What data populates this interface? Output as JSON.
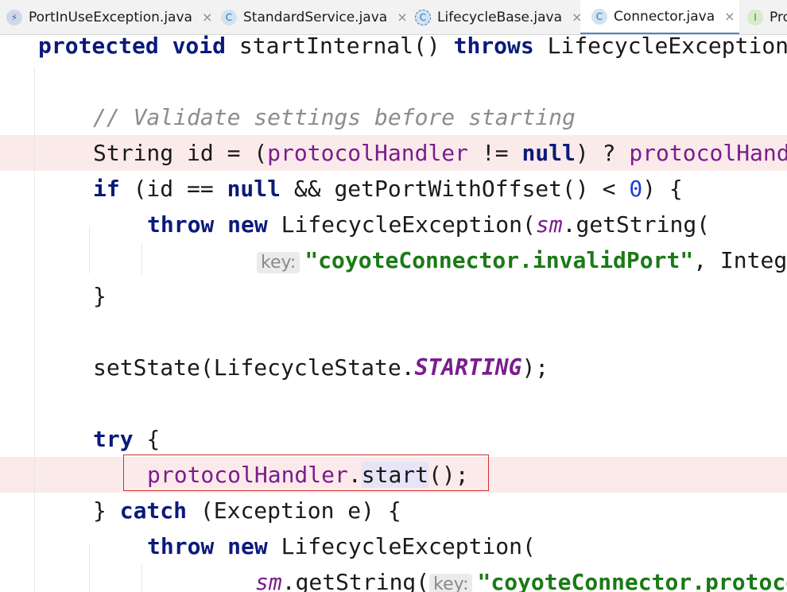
{
  "tabs": [
    {
      "label": "PortInUseException.java",
      "icon": "lightning-icon",
      "icon_glyph": "⚡",
      "icon_bg": "#cfd8ea",
      "icon_color": "#4a5bb0"
    },
    {
      "label": "StandardService.java",
      "icon": "class-icon",
      "icon_glyph": "C",
      "icon_bg": "#cfe3f3",
      "icon_color": "#3a6fa8"
    },
    {
      "label": "LifecycleBase.java",
      "icon": "abstract-class-icon",
      "icon_glyph": "C",
      "icon_bg": "#cfe3f3",
      "icon_color": "#3a6fa8"
    },
    {
      "label": "Connector.java",
      "icon": "class-icon",
      "icon_glyph": "C",
      "icon_bg": "#cfe3f3",
      "icon_color": "#3a6fa8",
      "active": true
    },
    {
      "label": "Pro",
      "icon": "interface-icon",
      "icon_glyph": "I",
      "icon_bg": "#d6ebc9",
      "icon_color": "#4f8a2e"
    }
  ],
  "close_glyph": "×",
  "code": {
    "line1": {
      "t1": "protected",
      "t2": " ",
      "t3": "void",
      "t4": " startInternal() ",
      "t5": "throws",
      "t6": " LifecycleException"
    },
    "line2": {
      "t1": "// Validate settings before starting"
    },
    "line3": {
      "t1": "String id = (",
      "t2": "protocolHandler",
      "t3": " != ",
      "t4": "null",
      "t5": ") ? ",
      "t6": "protocolHandler"
    },
    "line4": {
      "t1": "if",
      "t2": " (id == ",
      "t3": "null",
      "t4": " && getPortWithOffset() < ",
      "t5": "0",
      "t6": ") {"
    },
    "line5": {
      "t1": "throw",
      "t2": " ",
      "t3": "new",
      "t4": " LifecycleException(",
      "t5": "sm",
      "t6": ".getString("
    },
    "line6": {
      "hint": "key:",
      "t1": "\"coyoteConnector.invalidPort\"",
      "t2": ", Integer"
    },
    "line7": {
      "t1": "}"
    },
    "line8": {
      "t1": "setState(LifecycleState.",
      "t2": "STARTING",
      "t3": ");"
    },
    "line9": {
      "t1": "try",
      "t2": " {"
    },
    "line10": {
      "t1": "protocolHandler",
      "t2": ".",
      "t3": "start",
      "t4": "();"
    },
    "line11": {
      "t1": "} ",
      "t2": "catch",
      "t3": " (Exception e) {"
    },
    "line12": {
      "t1": "throw",
      "t2": " ",
      "t3": "new",
      "t4": " LifecycleException("
    },
    "line13": {
      "t1": "sm",
      "t2": ".getString(",
      "hint": "key:",
      "t3": "\"coyoteConnector.protocolHandlerStartFailed\""
    }
  }
}
